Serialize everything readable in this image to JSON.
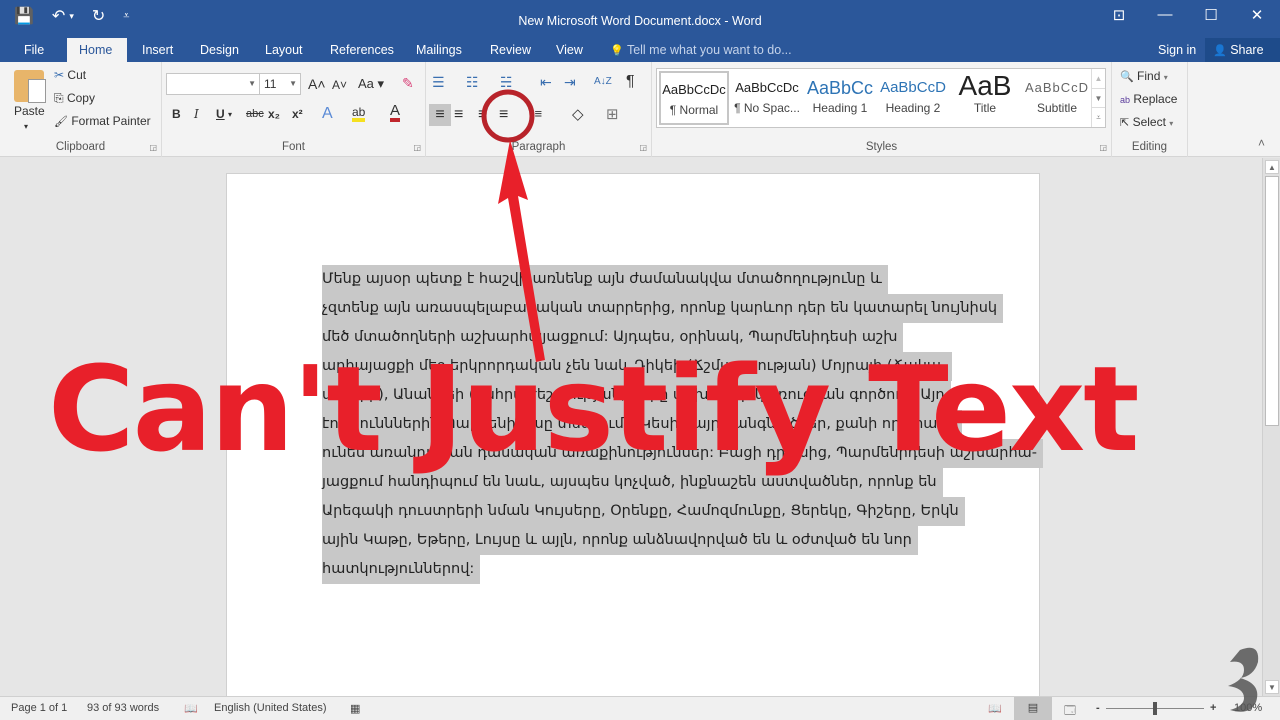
{
  "titlebar": {
    "title": "New Microsoft Word Document.docx - Word",
    "qat": {
      "save_icon": "💾",
      "undo_icon": "↶",
      "undo_dd": "▾",
      "redo_icon": "↻",
      "customize_icon": "⩡"
    },
    "window_controls": {
      "ribbon_display": "⊡",
      "minimize": "—",
      "maximize": "☐",
      "close": "✕"
    }
  },
  "tabs": [
    {
      "label": "File"
    },
    {
      "label": "Home"
    },
    {
      "label": "Insert"
    },
    {
      "label": "Design"
    },
    {
      "label": "Layout"
    },
    {
      "label": "References"
    },
    {
      "label": "Mailings"
    },
    {
      "label": "Review"
    },
    {
      "label": "View"
    }
  ],
  "tell_me": {
    "icon": "💡",
    "placeholder": "Tell me what you want to do..."
  },
  "account": {
    "sign_in": "Sign in",
    "share": "Share",
    "share_icon": "👤"
  },
  "clipboard": {
    "label": "Clipboard",
    "paste": "Paste",
    "cut": "Cut",
    "cut_icon": "✂",
    "copy": "Copy",
    "copy_icon": "⎘",
    "format_painter": "Format Painter",
    "format_painter_icon": "🖌"
  },
  "font": {
    "label": "Font",
    "font_name": "",
    "font_size": "11",
    "grow": "A˄",
    "shrink": "A˅",
    "change_case": "Aa ▾",
    "clear_format": "✎",
    "bold": "B",
    "italic": "I",
    "underline": "U",
    "strikethrough": "abc",
    "subscript": "x₂",
    "superscript": "x²",
    "text_effects": "A",
    "highlight": "ab",
    "font_color": "A"
  },
  "paragraph": {
    "label": "Paragraph",
    "bullets": "☰",
    "numbering": "☷",
    "multilevel": "☵",
    "decrease_indent": "⇤",
    "increase_indent": "⇥",
    "sort": "A↓Z",
    "show_marks": "¶",
    "align_left": "≡",
    "center": "≡",
    "align_right": "≡",
    "justify": "≡",
    "line_spacing": "↕≡",
    "shading": "◇",
    "borders": "⊞"
  },
  "styles": {
    "label": "Styles",
    "items": [
      {
        "preview": "AaBbCcDc",
        "name": "¶ Normal",
        "selected": true
      },
      {
        "preview": "AaBbCcDc",
        "name": "¶ No Spac...",
        "selected": false
      },
      {
        "preview": "AaBbCc",
        "name": "Heading 1",
        "selected": false
      },
      {
        "preview": "AaBbCcD",
        "name": "Heading 2",
        "selected": false
      },
      {
        "preview": "AaB",
        "name": "Title",
        "selected": false
      },
      {
        "preview": "AaBbCcD",
        "name": "Subtitle",
        "selected": false
      }
    ]
  },
  "editing": {
    "label": "Editing",
    "find": "Find",
    "find_icon": "🔍",
    "replace": "Replace",
    "replace_icon": "ab→ac",
    "select": "Select",
    "select_icon": "⇱",
    "collapse_icon": "˄"
  },
  "document": {
    "lines": [
      "Մենք այսօր պետք է հաշվի առնենք այն ժամանակվա մտածողությունը և",
      "չզտենք այն առասպելաբանական տարրերից, որոնք կարևոր դեր են կատարել նույնիսկ",
      "մեծ մտածողների աշխարհայացքում: Այդպես, օրինակ, Պարմենիդեսի աշխ",
      "արհայացքի մեջ երկրորդական չեն նաև Դիկեի (Ճշմարտության) Մոյրայի (Ճակա-",
      "տագրի), Անանկեի (Անհրաժեշտության) դերը աշխարհի կառուցման գործում: Այդ",
      "էությունններին Պարմենիդեսը տեսնում է Կեսի մայր կանգնածներ, քանի որ նրանք",
      "ունեն առանդական դասական առաքինություններ: Բացի դրանից, Պարմենիդեսի աշխարհա-",
      "յացքում հանդիպում են նաև, այսպես կոչված, ինքնաշեն աստվածներ, որոնք են",
      "Արեգակի դուստրերի նման Կույսերը, Օրենքը, Համոզմունքը, Ցերեկը, Գիշերը, Երկն",
      "ային Կաթը, Եթերը, Լույսը և այլն, որոնք անձնավորված են և օժտված են նոր",
      "հատկություններով:"
    ]
  },
  "overlay": {
    "title": "Can't Justify Text",
    "accent": "#e8202a"
  },
  "statusbar": {
    "page": "Page 1 of 1",
    "words": "93 of 93 words",
    "proofing_icon": "📖",
    "language": "English (United States)",
    "macro_icon": "▦",
    "read_mode_icon": "📖",
    "print_layout_icon": "▤",
    "web_layout_icon": "🗔",
    "zoom_minus": "-",
    "zoom_plus": "+",
    "zoom": "100%"
  },
  "colors": {
    "brand": "#2b579a",
    "ribbon_bg": "#f3f3f3",
    "selection": "#c8c8c8",
    "annotation": "#e8202a"
  }
}
